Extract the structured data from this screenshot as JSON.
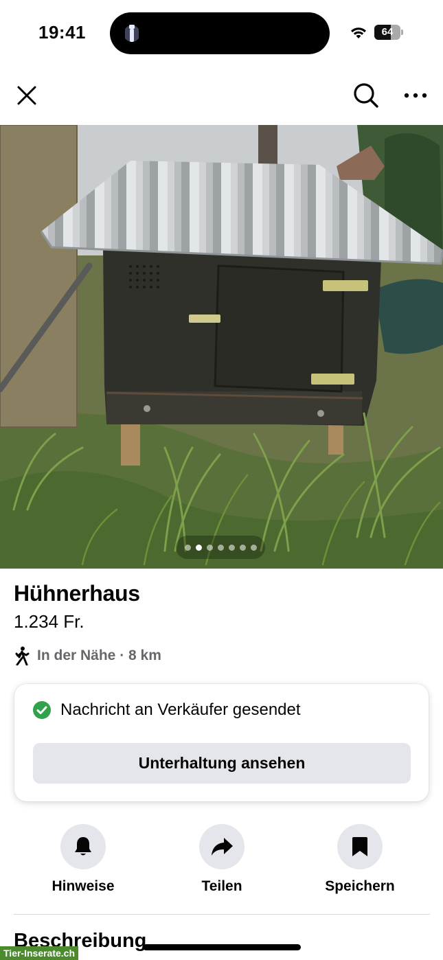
{
  "status_bar": {
    "time": "19:41",
    "battery_percent": "64",
    "battery_level": 0.64,
    "torch_icon": "flashlight-icon",
    "wifi_icon": "wifi-icon"
  },
  "nav": {
    "close_icon": "close-icon",
    "search_icon": "search-icon",
    "more_icon": "more-dots-icon"
  },
  "photo": {
    "page_count": 7,
    "active_index": 1
  },
  "listing": {
    "title": "Hühnerhaus",
    "price": "1.234 Fr.",
    "location": "In der Nähe · 8 km",
    "location_icon": "walking-person-icon"
  },
  "message_card": {
    "status_text": "Nachricht an Verkäufer gesendet",
    "status_icon": "check-circle-icon",
    "status_color": "#31a24c",
    "button_label": "Unterhaltung ansehen"
  },
  "actions": [
    {
      "label": "Hinweise",
      "icon": "bell-icon"
    },
    {
      "label": "Teilen",
      "icon": "share-arrow-icon"
    },
    {
      "label": "Speichern",
      "icon": "bookmark-icon"
    }
  ],
  "description": {
    "heading": "Beschreibung"
  },
  "watermark": "Tier-Inserate.ch"
}
